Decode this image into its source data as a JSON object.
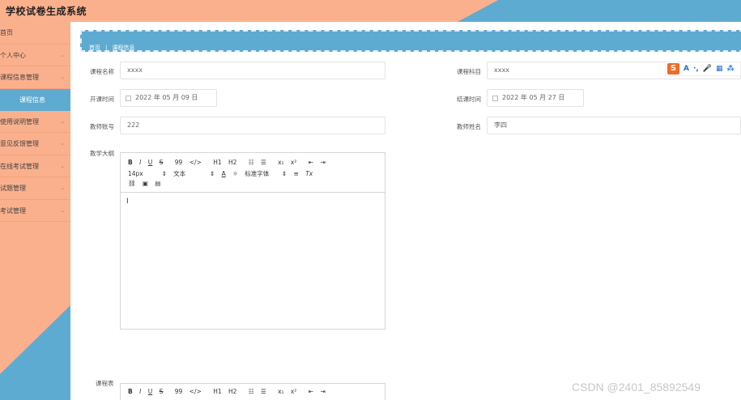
{
  "app": {
    "title": "学校试卷生成系统"
  },
  "sidebar": {
    "items": [
      {
        "label": "首页",
        "chevron": ""
      },
      {
        "label": "个人中心",
        "chevron": "⌄"
      },
      {
        "label": "课程信息管理",
        "chevron": "⌄",
        "expanded": true
      },
      {
        "label": "使用说明管理",
        "chevron": "⌄"
      },
      {
        "label": "意见反馈管理",
        "chevron": "⌄"
      },
      {
        "label": "在线考试管理",
        "chevron": "⌄"
      },
      {
        "label": "试题管理",
        "chevron": "⌄"
      },
      {
        "label": "考试管理",
        "chevron": "⌄"
      }
    ],
    "active_sub_label": "课程信息"
  },
  "breadcrumb": {
    "home": "首页",
    "separator": "|",
    "current": "课程信息"
  },
  "form": {
    "course_name": {
      "label": "课程名称",
      "value": "xxxx"
    },
    "course_subject": {
      "label": "课程科目",
      "value": "xxxx"
    },
    "start_time": {
      "label": "开课时间",
      "value": "2022 年 05 月 09 日"
    },
    "end_time": {
      "label": "结课时间",
      "value": "2022 年 05 月 27 日"
    },
    "teacher_id": {
      "label": "教师账号",
      "value": "222"
    },
    "teacher_name": {
      "label": "教师姓名",
      "value": "李四"
    },
    "syllabus": {
      "label": "教学大纲"
    },
    "schedule": {
      "label": "课程表"
    }
  },
  "editor": {
    "row1": [
      "B",
      "I",
      "U",
      "S",
      "99",
      "</>",
      "H1",
      "H2",
      "☷",
      "☰",
      "x₁",
      "x²",
      "⇤",
      "⇥"
    ],
    "row2": {
      "font_size": "14px",
      "paragraph": "文本",
      "color": "A",
      "font_family": "标准字体",
      "align": "≡",
      "clear": "Tx"
    },
    "row3": [
      "🔗",
      "▣",
      "▤"
    ],
    "content_cursor": "I"
  },
  "ime": {
    "logo": "S",
    "icons": [
      "A",
      "·,",
      "🎤",
      "▦",
      "⁂"
    ]
  },
  "watermark": "CSDN @2401_85892549",
  "colors": {
    "salmon": "#fbb08d",
    "blue": "#5eabd1"
  }
}
